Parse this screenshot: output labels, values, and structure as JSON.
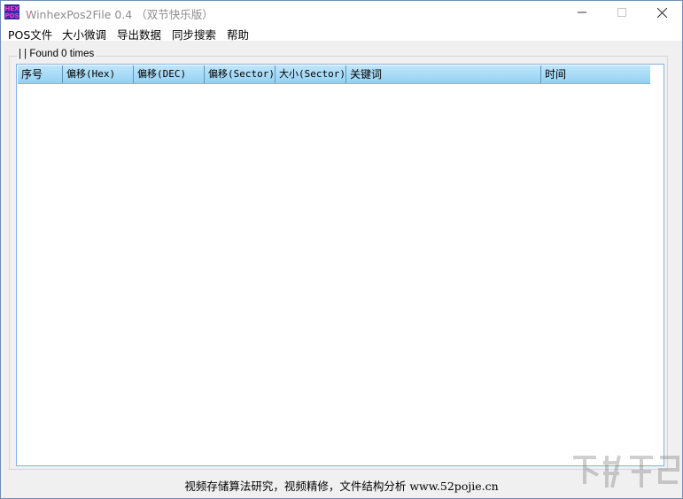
{
  "window": {
    "icon_text": "HEX POS",
    "title": "WinhexPos2File  0.4 （双节快乐版）",
    "controls": {
      "minimize": "—",
      "maximize": "☐",
      "close": "✕"
    }
  },
  "menu": [
    {
      "label": "POS文件"
    },
    {
      "label": "大小微调"
    },
    {
      "label": "导出数据"
    },
    {
      "label": "同步搜索"
    },
    {
      "label": "帮助"
    }
  ],
  "results": {
    "group_label": "| | Found 0 times",
    "columns": [
      {
        "label": "序号"
      },
      {
        "label": "偏移(Hex)"
      },
      {
        "label": "偏移(DEC)"
      },
      {
        "label": "偏移(Sector)"
      },
      {
        "label": "大小(Sector)"
      },
      {
        "label": "关键词"
      },
      {
        "label": "时间"
      }
    ],
    "rows": []
  },
  "status": {
    "text": "视频存储算法研究，视频精修，文件结构分析 www.52pojie.cn"
  }
}
